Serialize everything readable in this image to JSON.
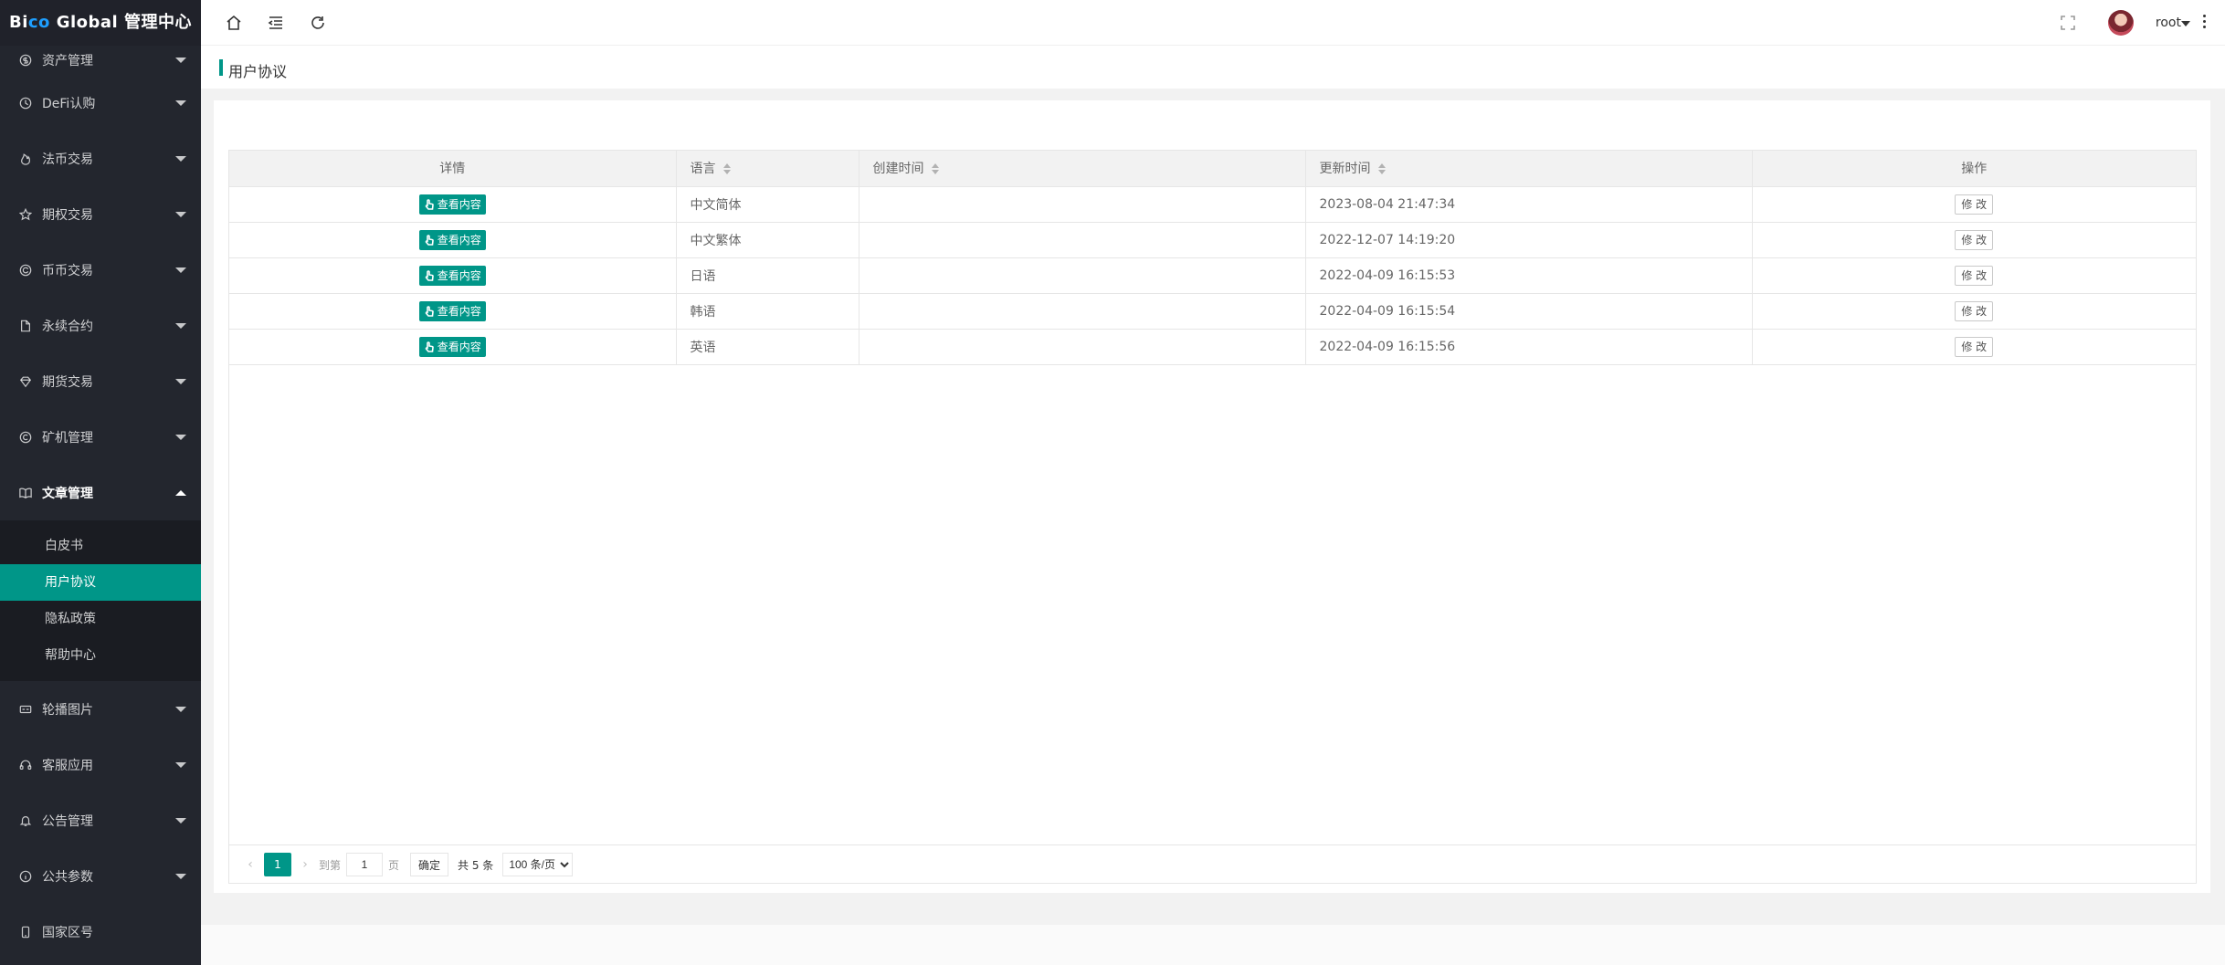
{
  "logo": {
    "prefix": "Bi",
    "highlight": "co",
    "suffix": " Global 管理中心"
  },
  "sidebar": {
    "items_before": [
      {
        "label": "资产管理",
        "icon": "dollar-circle-icon"
      },
      {
        "label": "DeFi认购",
        "icon": "clock-icon"
      },
      {
        "label": "法币交易",
        "icon": "fire-icon"
      },
      {
        "label": "期权交易",
        "icon": "star-icon"
      },
      {
        "label": "币币交易",
        "icon": "refresh-circle-icon"
      },
      {
        "label": "永续合约",
        "icon": "file-icon"
      },
      {
        "label": "期货交易",
        "icon": "diamond-icon"
      },
      {
        "label": "矿机管理",
        "icon": "copyright-icon"
      }
    ],
    "open_item": {
      "label": "文章管理",
      "icon": "book-icon"
    },
    "sub_items": [
      {
        "label": "白皮书"
      },
      {
        "label": "用户协议",
        "active": true
      },
      {
        "label": "隐私政策"
      },
      {
        "label": "帮助中心"
      }
    ],
    "items_after": [
      {
        "label": "轮播图片",
        "icon": "slider-icon"
      },
      {
        "label": "客服应用",
        "icon": "headset-icon"
      },
      {
        "label": "公告管理",
        "icon": "bell-icon"
      },
      {
        "label": "公共参数",
        "icon": "info-icon"
      },
      {
        "label": "国家区号",
        "icon": "phone-icon"
      }
    ]
  },
  "header": {
    "username": "root"
  },
  "breadcrumb": {
    "title": "用户协议"
  },
  "table": {
    "columns": [
      "详情",
      "语言",
      "创建时间",
      "更新时间",
      "操作"
    ],
    "view_label": "查看内容",
    "edit_label": "修 改",
    "rows": [
      {
        "language": "中文简体",
        "created": "",
        "updated": "2023-08-04 21:47:34"
      },
      {
        "language": "中文繁体",
        "created": "",
        "updated": "2022-12-07 14:19:20"
      },
      {
        "language": "日语",
        "created": "",
        "updated": "2022-04-09 16:15:53"
      },
      {
        "language": "韩语",
        "created": "",
        "updated": "2022-04-09 16:15:54"
      },
      {
        "language": "英语",
        "created": "",
        "updated": "2022-04-09 16:15:56"
      }
    ]
  },
  "pager": {
    "current_page": "1",
    "goto_label": "到第",
    "page_label": "页",
    "goto_value": "1",
    "confirm_label": "确定",
    "total_label": "共 5 条",
    "per_page": "100 条/页"
  },
  "colors": {
    "accent": "#009688",
    "sidebar_bg": "#23262e",
    "logo_highlight": "#1e9fff"
  }
}
